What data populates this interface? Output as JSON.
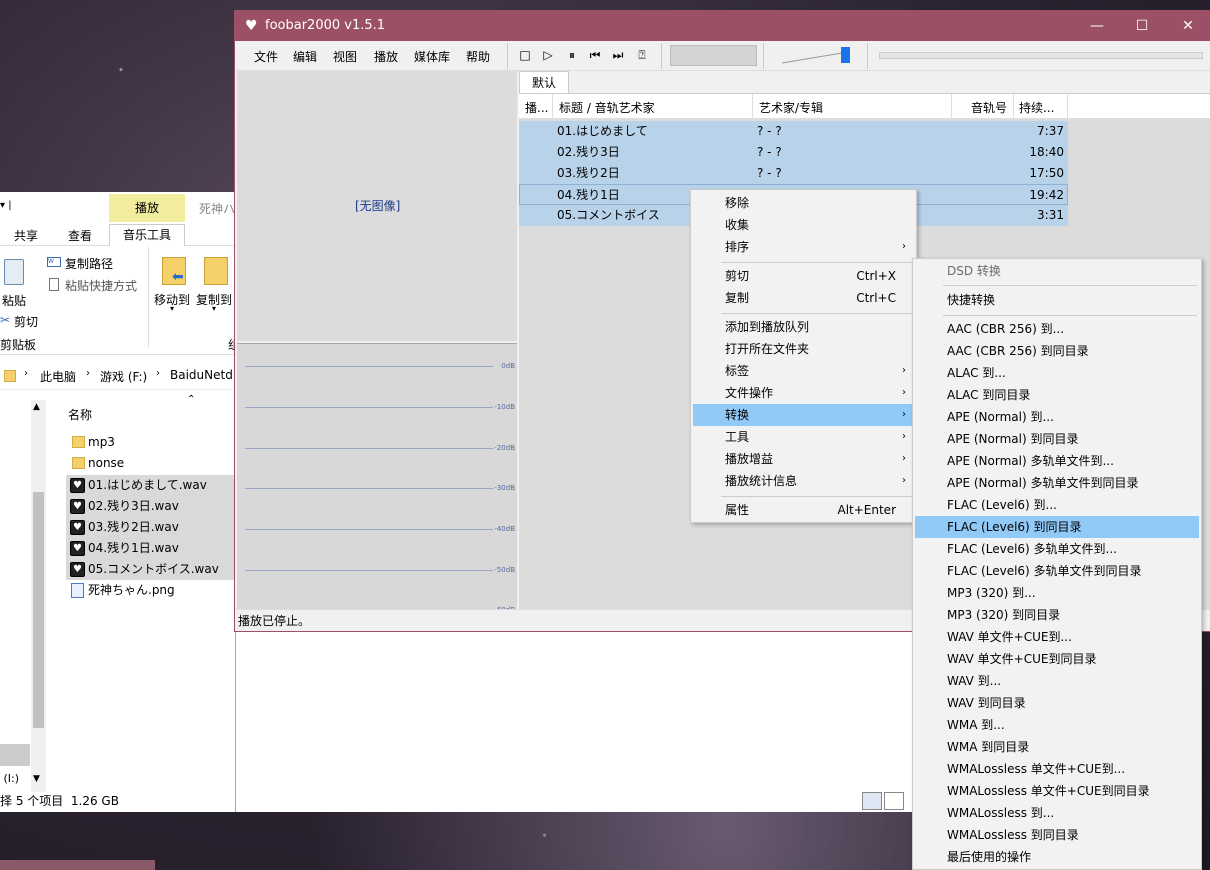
{
  "explorer": {
    "ctx_tab": "播放",
    "ctx_tab2": "死神ハ",
    "tabs": [
      "共享",
      "查看",
      "音乐工具"
    ],
    "ribbon": {
      "paste": "粘贴",
      "copy_path": "复制路径",
      "paste_shortcut": "粘贴快捷方式",
      "cut": "剪切",
      "move_to": "移动到",
      "copy_to": "复制到",
      "clipboard_group": "剪贴板",
      "org_group_partial": "组"
    },
    "address": [
      "此电脑",
      "游戏 (F:)",
      "BaiduNetd"
    ],
    "column_name": "名称",
    "files": [
      {
        "name": "mp3",
        "type": "folder",
        "selected": false
      },
      {
        "name": "nonse",
        "type": "folder",
        "selected": false
      },
      {
        "name": "01.はじめまして.wav",
        "type": "wav",
        "selected": true
      },
      {
        "name": "02.残り3日.wav",
        "type": "wav",
        "selected": true
      },
      {
        "name": "03.残り2日.wav",
        "type": "wav",
        "selected": true
      },
      {
        "name": "04.残り1日.wav",
        "type": "wav",
        "selected": true
      },
      {
        "name": "05.コメントボイス.wav",
        "type": "wav",
        "selected": true
      },
      {
        "name": "死神ちゃん.png",
        "type": "png",
        "selected": false
      }
    ],
    "drive_partial": " (I:)",
    "status": "择 5 个项目  1.26 GB"
  },
  "foobar": {
    "title": "foobar2000 v1.5.1",
    "menu": [
      "文件",
      "编辑",
      "视图",
      "播放",
      "媒体库",
      "帮助"
    ],
    "album_art": "[无图像]",
    "db_labels": [
      "0dB",
      "-10dB",
      "-20dB",
      "-30dB",
      "-40dB",
      "-50dB",
      "-60dB"
    ],
    "playlist_tab": "默认",
    "columns": [
      "播...",
      "标题 / 音轨艺术家",
      "艺术家/专辑",
      "音轨号",
      "持续..."
    ],
    "tracks": [
      {
        "title": "01.はじめまして",
        "artist": "? - ?",
        "duration": "7:37"
      },
      {
        "title": "02.残り3日",
        "artist": "? - ?",
        "duration": "18:40"
      },
      {
        "title": "03.残り2日",
        "artist": "? - ?",
        "duration": "17:50"
      },
      {
        "title": "04.残り1日",
        "artist": "? - ?",
        "duration": "19:42"
      },
      {
        "title": "05.コメントボイス",
        "artist": "? - ?",
        "duration": "3:31"
      }
    ],
    "status": "播放已停止。"
  },
  "context_menu": {
    "remove": "移除",
    "collect": "收集",
    "sort": "排序",
    "cut": "剪切",
    "cut_sc": "Ctrl+X",
    "copy": "复制",
    "copy_sc": "Ctrl+C",
    "add_queue": "添加到播放队列",
    "open_folder": "打开所在文件夹",
    "tags": "标签",
    "file_ops": "文件操作",
    "convert": "转换",
    "tools": "工具",
    "replay_gain": "播放增益",
    "stats": "播放统计信息",
    "properties": "属性",
    "properties_sc": "Alt+Enter"
  },
  "convert_menu": {
    "dsd": "DSD 转换",
    "quick": "快捷转换",
    "items": [
      "AAC (CBR 256) 到...",
      "AAC (CBR 256) 到同目录",
      "ALAC 到...",
      "ALAC 到同目录",
      "APE (Normal) 到...",
      "APE (Normal) 到同目录",
      "APE (Normal) 多轨单文件到...",
      "APE (Normal) 多轨单文件到同目录",
      "FLAC (Level6) 到...",
      "FLAC (Level6) 到同目录",
      "FLAC (Level6) 多轨单文件到...",
      "FLAC (Level6) 多轨单文件到同目录",
      "MP3 (320) 到...",
      "MP3 (320) 到同目录",
      "WAV 单文件+CUE到...",
      "WAV 单文件+CUE到同目录",
      "WAV 到...",
      "WAV 到同目录",
      "WMA 到...",
      "WMA 到同目录",
      "WMALossless 单文件+CUE到...",
      "WMALossless 单文件+CUE到同目录",
      "WMALossless 到...",
      "WMALossless 到同目录",
      "最后使用的操作"
    ],
    "highlighted_index": 9
  },
  "colors": {
    "titlebar": "#9b5066",
    "selection": "#b8d2ea",
    "menu_highlight": "#91c9f7",
    "context_tab": "#f2ec9e"
  }
}
